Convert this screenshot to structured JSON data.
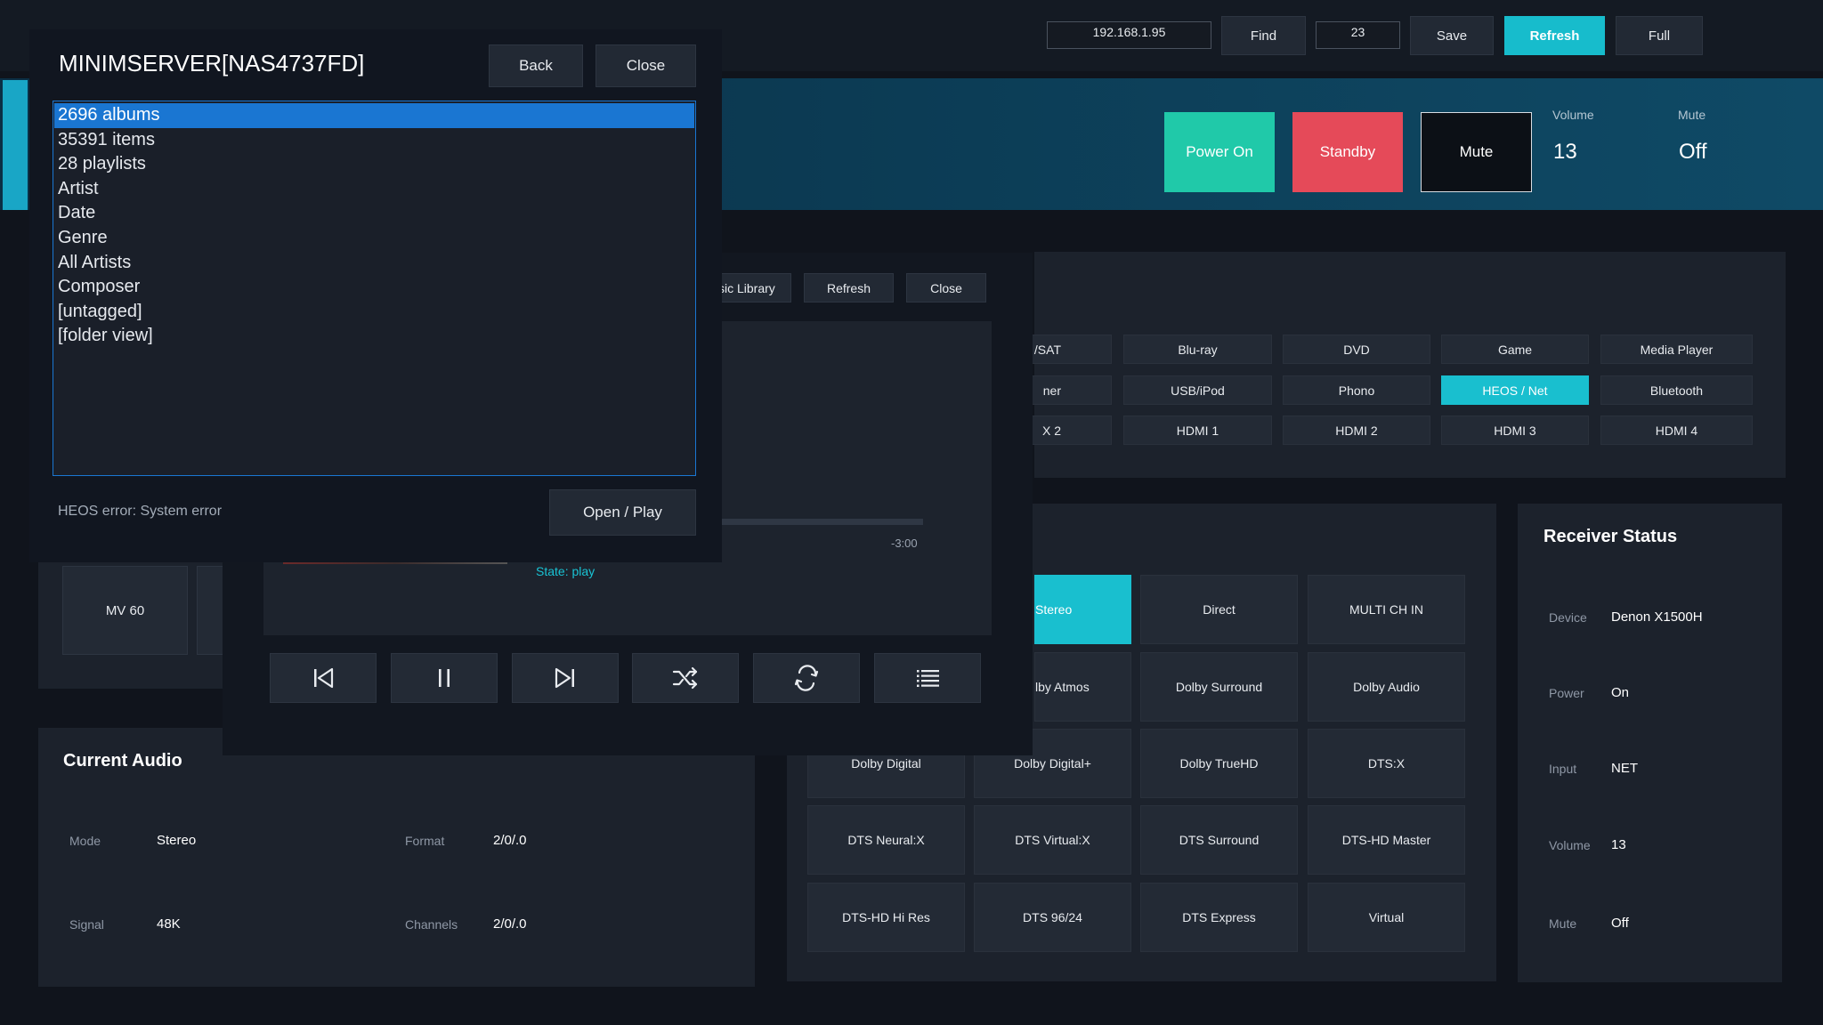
{
  "topbar": {
    "ip": "192.168.1.95",
    "find": "Find",
    "port": "23",
    "save": "Save",
    "refresh": "Refresh",
    "full": "Full"
  },
  "power": {
    "on": "Power On",
    "standby": "Standby",
    "mute": "Mute",
    "volume_label": "Volume",
    "volume_value": "13",
    "mute_label": "Mute",
    "mute_value": "Off"
  },
  "browser": {
    "title": "MINIMSERVER[NAS4737FD]",
    "back": "Back",
    "close": "Close",
    "items": [
      "2696 albums",
      "35391 items",
      "28 playlists",
      "Artist",
      "Date",
      "Genre",
      "All Artists",
      "Composer",
      "[untagged]",
      "[folder view]"
    ],
    "selected": 0,
    "error": "HEOS error: System error",
    "open_play": "Open / Play"
  },
  "player": {
    "library": "sic Library",
    "refresh": "Refresh",
    "close": "Close",
    "time_remaining": "-3:00",
    "state": "State: play",
    "progress": 0
  },
  "favorites": {
    "item1": "MV 60"
  },
  "inputs": [
    [
      "/SAT",
      "Blu-ray",
      "DVD",
      "Game",
      "Media Player"
    ],
    [
      "ner",
      "USB/iPod",
      "Phono",
      "HEOS / Net",
      "Bluetooth"
    ],
    [
      "X 2",
      "HDMI 1",
      "HDMI 2",
      "HDMI 3",
      "HDMI 4"
    ]
  ],
  "inputs_active": "HEOS / Net",
  "modes": [
    [
      "Stereo",
      "Direct",
      "MULTI CH IN"
    ],
    [
      "lby Atmos",
      "Dolby Surround",
      "Dolby Audio"
    ],
    [
      "Dolby Digital",
      "Dolby Digital+",
      "Dolby TrueHD",
      "DTS:X"
    ],
    [
      "DTS Neural:X",
      "DTS Virtual:X",
      "DTS Surround",
      "DTS-HD Master"
    ],
    [
      "DTS-HD Hi Res",
      "DTS 96/24",
      "DTS Express",
      "Virtual"
    ]
  ],
  "modes_active": "Stereo",
  "current_audio": {
    "title": "Current Audio",
    "mode_label": "Mode",
    "mode": "Stereo",
    "format_label": "Format",
    "format": "2/0/.0",
    "signal_label": "Signal",
    "signal": "48K",
    "channels_label": "Channels",
    "channels": "2/0/.0"
  },
  "status": {
    "title": "Receiver Status",
    "device_label": "Device",
    "device": "Denon X1500H",
    "power_label": "Power",
    "power": "On",
    "input_label": "Input",
    "input": "NET",
    "volume_label": "Volume",
    "volume": "13",
    "mute_label": "Mute",
    "mute": "Off"
  },
  "icons": [
    "previous-icon",
    "pause-icon",
    "next-icon",
    "shuffle-icon",
    "repeat-icon",
    "queue-list-icon"
  ]
}
